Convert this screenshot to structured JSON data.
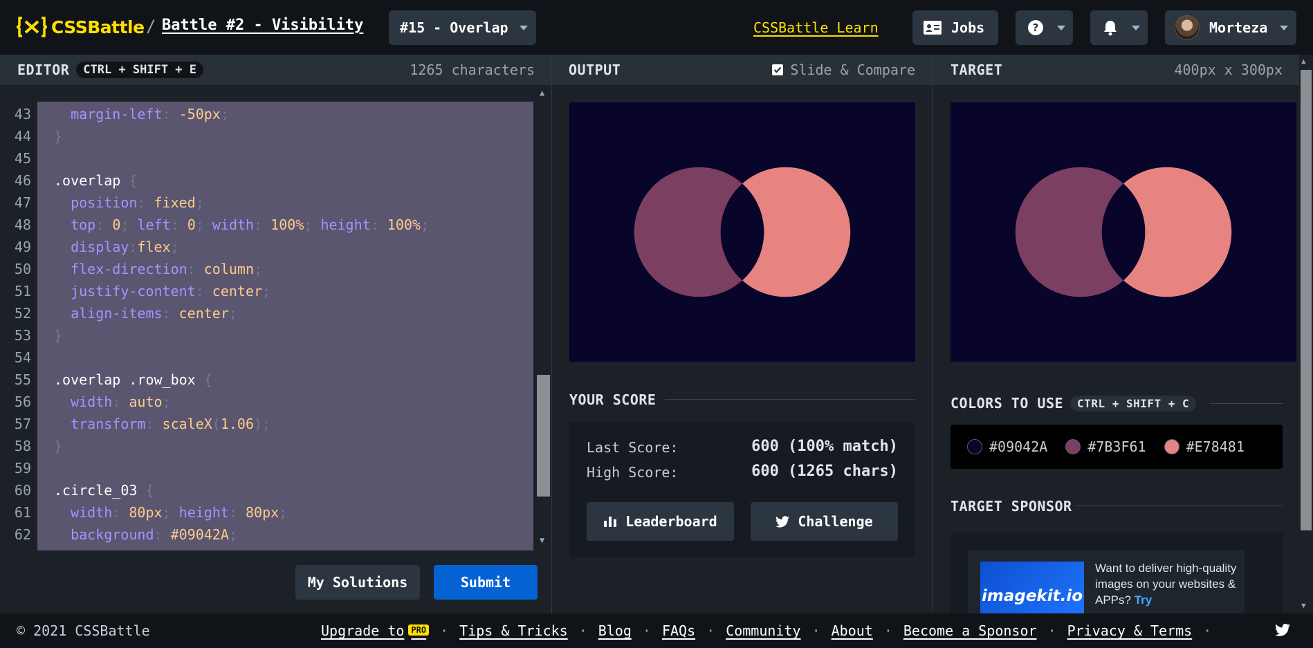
{
  "header": {
    "logo_text": "CSSBattle",
    "breadcrumb_separator": "/",
    "battle_title": "Battle #2 - Visibility",
    "target_select_label": "#15 - Overlap",
    "learn_link": "CSSBattle Learn",
    "jobs_label": "Jobs",
    "user_name": "Morteza"
  },
  "editor": {
    "title": "EDITOR",
    "shortcut": "CTRL + SHIFT + E",
    "char_count": "1265 characters",
    "lines": [
      {
        "n": "43",
        "parts": [
          [
            "prop",
            "  margin-left"
          ],
          [
            "punc",
            ": "
          ],
          [
            "val",
            "-50px"
          ],
          [
            "punc",
            ";"
          ]
        ]
      },
      {
        "n": "44",
        "parts": [
          [
            "punc",
            "}"
          ]
        ]
      },
      {
        "n": "45",
        "parts": []
      },
      {
        "n": "46",
        "parts": [
          [
            "sel",
            ".overlap "
          ],
          [
            "punc",
            "{"
          ]
        ]
      },
      {
        "n": "47",
        "parts": [
          [
            "prop",
            "  position"
          ],
          [
            "punc",
            ": "
          ],
          [
            "val",
            "fixed"
          ],
          [
            "punc",
            ";"
          ]
        ]
      },
      {
        "n": "48",
        "parts": [
          [
            "prop",
            "  top"
          ],
          [
            "punc",
            ": "
          ],
          [
            "val",
            "0"
          ],
          [
            "punc",
            "; "
          ],
          [
            "prop",
            "left"
          ],
          [
            "punc",
            ": "
          ],
          [
            "val",
            "0"
          ],
          [
            "punc",
            "; "
          ],
          [
            "prop",
            "width"
          ],
          [
            "punc",
            ": "
          ],
          [
            "val",
            "100%"
          ],
          [
            "punc",
            "; "
          ],
          [
            "prop",
            "height"
          ],
          [
            "punc",
            ": "
          ],
          [
            "val",
            "100%"
          ],
          [
            "punc",
            ";"
          ]
        ]
      },
      {
        "n": "49",
        "parts": [
          [
            "prop",
            "  display"
          ],
          [
            "punc",
            ":"
          ],
          [
            "val",
            "flex"
          ],
          [
            "punc",
            ";"
          ]
        ]
      },
      {
        "n": "50",
        "parts": [
          [
            "prop",
            "  flex-direction"
          ],
          [
            "punc",
            ": "
          ],
          [
            "val",
            "column"
          ],
          [
            "punc",
            ";"
          ]
        ]
      },
      {
        "n": "51",
        "parts": [
          [
            "prop",
            "  justify-content"
          ],
          [
            "punc",
            ": "
          ],
          [
            "val",
            "center"
          ],
          [
            "punc",
            ";"
          ]
        ]
      },
      {
        "n": "52",
        "parts": [
          [
            "prop",
            "  align-items"
          ],
          [
            "punc",
            ": "
          ],
          [
            "val",
            "center"
          ],
          [
            "punc",
            ";"
          ]
        ]
      },
      {
        "n": "53",
        "parts": [
          [
            "punc",
            "}"
          ]
        ]
      },
      {
        "n": "54",
        "parts": []
      },
      {
        "n": "55",
        "parts": [
          [
            "sel",
            ".overlap .row_box "
          ],
          [
            "punc",
            "{"
          ]
        ]
      },
      {
        "n": "56",
        "parts": [
          [
            "prop",
            "  width"
          ],
          [
            "punc",
            ": "
          ],
          [
            "val",
            "auto"
          ],
          [
            "punc",
            ";"
          ]
        ]
      },
      {
        "n": "57",
        "parts": [
          [
            "prop",
            "  transform"
          ],
          [
            "punc",
            ": "
          ],
          [
            "val",
            "scaleX"
          ],
          [
            "punc",
            "("
          ],
          [
            "val",
            "1.06"
          ],
          [
            "punc",
            ");"
          ]
        ]
      },
      {
        "n": "58",
        "parts": [
          [
            "punc",
            "}"
          ]
        ]
      },
      {
        "n": "59",
        "parts": []
      },
      {
        "n": "60",
        "parts": [
          [
            "sel",
            ".circle_03 "
          ],
          [
            "punc",
            "{"
          ]
        ]
      },
      {
        "n": "61",
        "parts": [
          [
            "prop",
            "  width"
          ],
          [
            "punc",
            ": "
          ],
          [
            "val",
            "80px"
          ],
          [
            "punc",
            "; "
          ],
          [
            "prop",
            "height"
          ],
          [
            "punc",
            ": "
          ],
          [
            "val",
            "80px"
          ],
          [
            "punc",
            ";"
          ]
        ]
      },
      {
        "n": "62",
        "parts": [
          [
            "prop",
            "  background"
          ],
          [
            "punc",
            ": "
          ],
          [
            "val",
            "#09042A"
          ],
          [
            "punc",
            ";"
          ]
        ]
      }
    ],
    "my_solutions_label": "My Solutions",
    "submit_label": "Submit"
  },
  "output": {
    "title": "OUTPUT",
    "compare_label": "Slide & Compare"
  },
  "target": {
    "title": "TARGET",
    "size_label": "400px x 300px"
  },
  "score": {
    "title": "YOUR SCORE",
    "last_label": "Last Score:",
    "last_value": "600 (100% match)",
    "high_label": "High Score:",
    "high_value": "600 (1265 chars)",
    "leaderboard_label": "Leaderboard",
    "challenge_label": "Challenge"
  },
  "colors": {
    "title": "COLORS TO USE",
    "shortcut": "CTRL + SHIFT + C",
    "swatches": [
      {
        "hex": "#09042A",
        "label": "#09042A"
      },
      {
        "hex": "#7B3F61",
        "label": "#7B3F61"
      },
      {
        "hex": "#E78481",
        "label": "#E78481"
      }
    ]
  },
  "sponsor": {
    "title": "TARGET SPONSOR",
    "logo_text": "imagekit.io",
    "text": "Want to deliver high-quality images on your websites & APPs?",
    "try_text": "Try"
  },
  "footer": {
    "copyright": "© 2021 CSSBattle",
    "upgrade": "Upgrade to",
    "pro_badge": "PRO",
    "links": [
      "Tips & Tricks",
      "Blog",
      "FAQs",
      "Community",
      "About",
      "Become a Sponsor",
      "Privacy & Terms"
    ]
  }
}
